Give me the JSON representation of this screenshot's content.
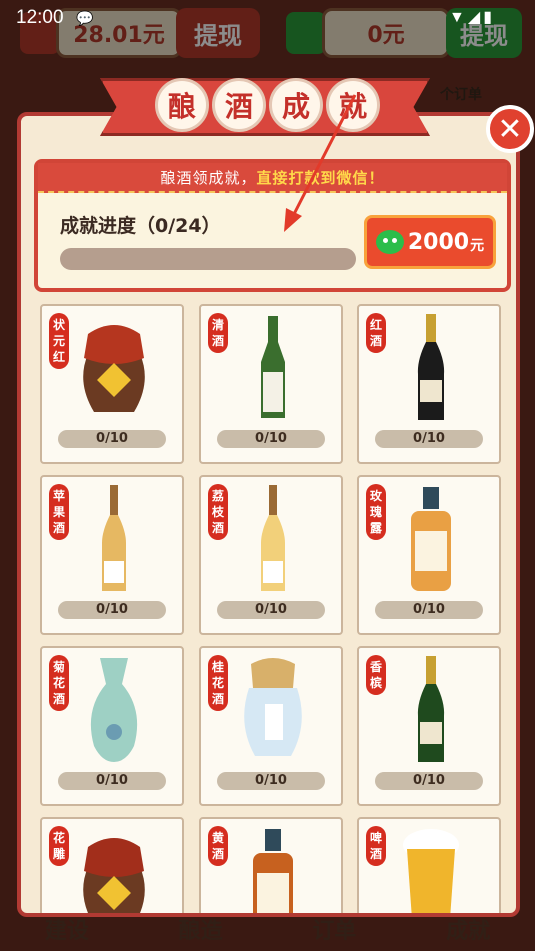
{
  "status_bar": {
    "time": "12:00",
    "chat_glyph": "💬",
    "right": "▼◢▮"
  },
  "background": {
    "balance1": "28.01元",
    "withdraw_label": "提现",
    "balance2": "0元",
    "withdraw_label2": "提现",
    "orders_label": "个订单",
    "bottom_nav": [
      "建设",
      "酿造",
      "订单",
      "成就"
    ]
  },
  "dialog": {
    "title_chars": [
      "酿",
      "酒",
      "成",
      "就"
    ],
    "close_glyph": "✕",
    "banner_prefix": "酿酒领成就，",
    "banner_highlight": "直接打款到微信！",
    "progress_label": "成就进度（0/24）",
    "progress_value": 0,
    "reward_amount": "2000",
    "reward_unit": "元"
  },
  "items": [
    {
      "tag": "状元红",
      "count": "0/10",
      "kind": "jar",
      "color": "#b5361f"
    },
    {
      "tag": "清酒",
      "count": "0/10",
      "kind": "sake",
      "color": "#3a6e2e"
    },
    {
      "tag": "红酒",
      "count": "0/10",
      "kind": "wine",
      "color": "#1b1b1b"
    },
    {
      "tag": "苹果酒",
      "count": "0/10",
      "kind": "tall",
      "color": "#e6b862"
    },
    {
      "tag": "荔枝酒",
      "count": "0/10",
      "kind": "tall",
      "color": "#f2d07a"
    },
    {
      "tag": "玫瑰露",
      "count": "0/10",
      "kind": "flask",
      "color": "#e9a044"
    },
    {
      "tag": "菊花酒",
      "count": "0/10",
      "kind": "vase",
      "color": "#9ed0c4"
    },
    {
      "tag": "桂花酒",
      "count": "0/10",
      "kind": "pot",
      "color": "#d6e8f4"
    },
    {
      "tag": "香槟",
      "count": "0/10",
      "kind": "wine",
      "color": "#1f4a1e"
    },
    {
      "tag": "花雕",
      "count": "",
      "kind": "jar",
      "color": "#a22e1b"
    },
    {
      "tag": "黄酒",
      "count": "",
      "kind": "flask",
      "color": "#c7611f"
    },
    {
      "tag": "啤酒",
      "count": "",
      "kind": "beer",
      "color": "#f0b52c"
    }
  ]
}
